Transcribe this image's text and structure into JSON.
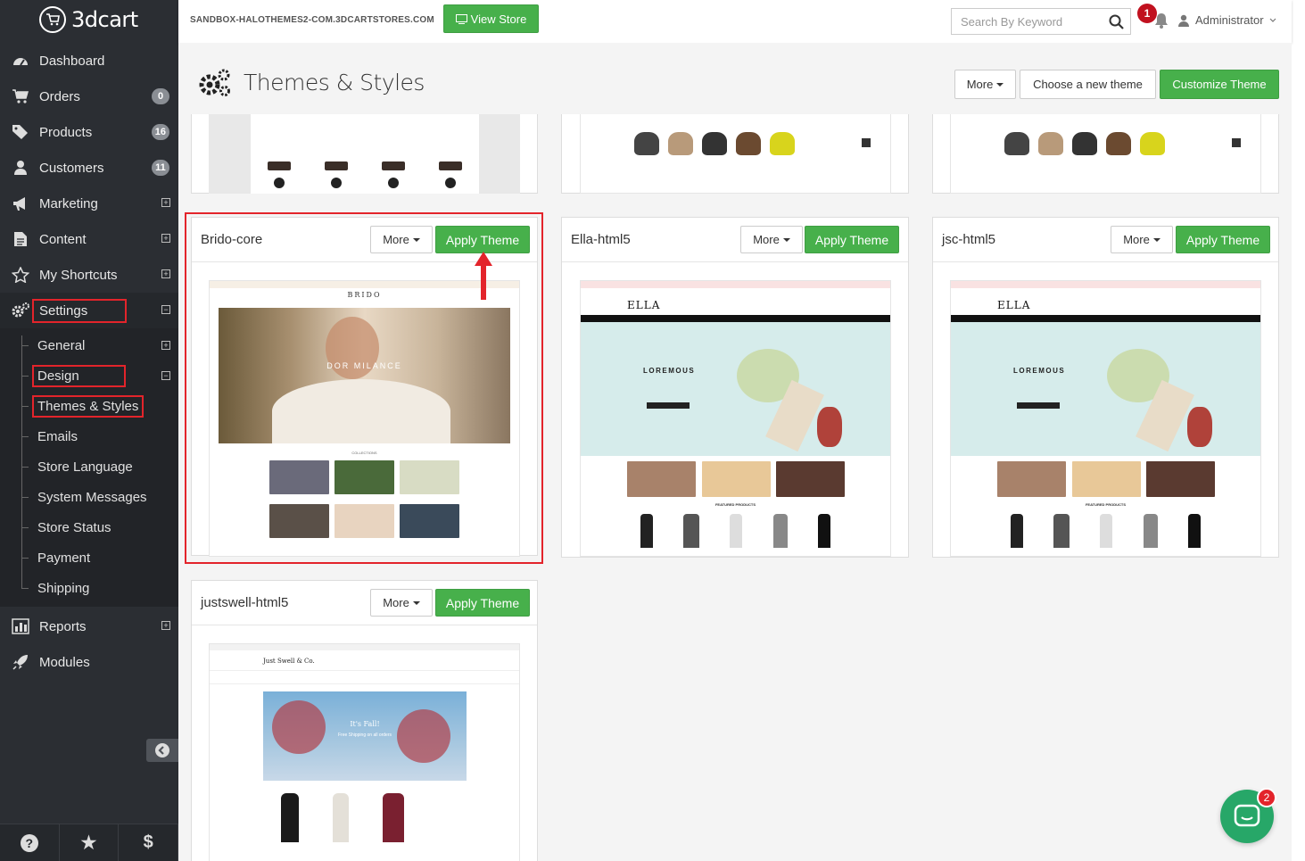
{
  "app": {
    "brand": "3dcart"
  },
  "sidebar": {
    "items": [
      {
        "label": "Dashboard",
        "icon": "dashboard-icon"
      },
      {
        "label": "Orders",
        "icon": "cart-icon",
        "badge": "0"
      },
      {
        "label": "Products",
        "icon": "tag-icon",
        "badge": "16"
      },
      {
        "label": "Customers",
        "icon": "user-icon",
        "badge": "11"
      },
      {
        "label": "Marketing",
        "icon": "megaphone-icon"
      },
      {
        "label": "Content",
        "icon": "document-icon"
      },
      {
        "label": "My Shortcuts",
        "icon": "star-icon"
      },
      {
        "label": "Settings",
        "icon": "gears-icon"
      }
    ],
    "settings_sub": [
      "General",
      "Design",
      "Themes & Styles",
      "Emails",
      "Store Language",
      "System Messages",
      "Store Status",
      "Payment",
      "Shipping"
    ],
    "after_items": [
      {
        "label": "Reports",
        "icon": "bar-chart-icon"
      },
      {
        "label": "Modules",
        "icon": "rocket-icon"
      }
    ],
    "footer": {
      "help": "?",
      "shortcuts": "★",
      "billing": "$"
    }
  },
  "topbar": {
    "store_url": "SANDBOX-HALOTHEMES2-COM.3DCARTSTORES.COM",
    "view_store": "View Store",
    "search_placeholder": "Search By Keyword",
    "notification_count": "1",
    "user": "Administrator"
  },
  "page": {
    "title": "Themes & Styles",
    "more": "More",
    "choose_theme": "Choose a new theme",
    "customize_theme": "Customize Theme"
  },
  "themes": [
    {
      "name": "Brido-core",
      "more": "More",
      "apply": "Apply Theme",
      "preview_brand": "BRIDO",
      "preview_hero": "DOR MILANCE",
      "preview_section": "COLLECTIONS"
    },
    {
      "name": "Ella-html5",
      "more": "More",
      "apply": "Apply Theme",
      "preview_brand": "ELLA",
      "preview_hero": "LOREMOUS",
      "preview_section": "FEATURED PRODUCTS"
    },
    {
      "name": "jsc-html5",
      "more": "More",
      "apply": "Apply Theme",
      "preview_brand": "ELLA",
      "preview_hero": "LOREMOUS",
      "preview_section": "FEATURED PRODUCTS"
    },
    {
      "name": "justswell-html5",
      "more": "More",
      "apply": "Apply Theme",
      "preview_brand": "Just Swell & Co.",
      "preview_hero": "It's Fall!",
      "preview_sub": "Free Shipping on all orders"
    }
  ],
  "chat": {
    "badge": "2"
  },
  "colors": {
    "sidebar": "#2b2e33",
    "green": "#47b04b",
    "highlight": "#e3242b",
    "badge": "#c1111f"
  }
}
